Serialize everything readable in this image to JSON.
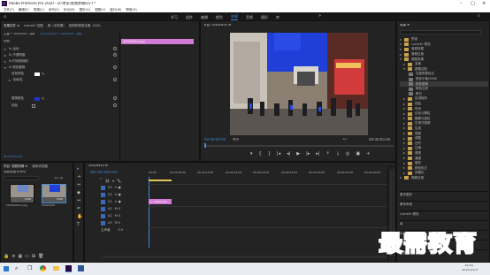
{
  "titlebar": {
    "title": "Adobe Premiere Pro 2020 - D:\\考家\\视频剪辑\\01.f *"
  },
  "menu": [
    "文件(F)",
    "编辑(E)",
    "剪辑(C)",
    "序列(S)",
    "标记(M)",
    "图形(G)",
    "视图(V)",
    "窗口(W)",
    "帮助(H)"
  ],
  "workspace_tabs": [
    "学习",
    "组件",
    "编辑",
    "颜色",
    "效果",
    "音频",
    "图形",
    "库"
  ],
  "workspace_active": "效果",
  "effect_controls": {
    "tabs": [
      "效果控件 ≡",
      "Lumetri 范围",
      "源: (无剪辑)",
      "音频剪辑混合器: 2020"
    ],
    "source_label": "主要 * 1000204...jpg",
    "clip_label": "2020206-0 * 1000204...jpg",
    "clip_block": "1000204U.jpg",
    "section_label": "视频",
    "rows": [
      "fx 运动",
      "fx 不透明度",
      "fx 时间重映射",
      "fx 颜色替换",
      "目标颜色",
      "相似性",
      "替换颜色",
      "纯色"
    ],
    "timecode": "00:00:00:00"
  },
  "program_monitor": {
    "title": "节目: 20020410 ≡",
    "timecode_left": "00:00:00:00",
    "fit_label": "适合",
    "page_label": "1/2",
    "timecode_right": "00:00:05:00"
  },
  "project": {
    "tabs": [
      "项目: 视频剪辑 ≡",
      "媒体浏览器"
    ],
    "path": "视频剪辑.prproj",
    "item_count": "1/2 项",
    "items": [
      {
        "name": "20201000-0.jpg",
        "duration": "5:00"
      },
      {
        "name": "20020410",
        "duration": "5:00"
      }
    ]
  },
  "timeline": {
    "title": "20020410 ≡",
    "timecode": "00:00:00:00",
    "ruler": [
      "00:00",
      "00:00:05:00",
      "00:00:10:00",
      "00:00:15:00",
      "00:00:20:00",
      "00:00:25:00",
      "00:00:30:00",
      "00:00:35:00",
      "00:00:40:00"
    ],
    "tracks": [
      "V3",
      "V2",
      "V1",
      "A1",
      "A2",
      "A3",
      "主声道"
    ],
    "master_value": "0.0",
    "clip_label": "fx 10020410..."
  },
  "effects": {
    "title": "效果 ≡",
    "tree": [
      "预设",
      "Lumetri 预设",
      "音频效果",
      "音频过渡",
      "视频效果",
      "变换",
      "图像控制",
      "灰度系数校正",
      "颜色平衡(RGB)",
      "颜色替换",
      "颜色过滤",
      "黑白",
      "实用程序",
      "扭曲",
      "时间",
      "杂色与颗粒",
      "模糊与锐化",
      "沉浸式视频",
      "生成",
      "视频",
      "调整",
      "过时",
      "过渡",
      "透视",
      "通道",
      "键控",
      "颜色校正",
      "风格化",
      "视频过渡"
    ],
    "bottom": [
      "基本图形",
      "基本声音",
      "Lumetri 颜色",
      "库",
      "标记",
      "历史记录",
      "信息"
    ]
  },
  "taskbar": {
    "time": "15:41",
    "date": "2021/11/3"
  },
  "watermark": "最需教育",
  "colors": {
    "accent": "#3f8bd9",
    "clip": "#d17ad6",
    "track_blue": "#3a69b5"
  }
}
